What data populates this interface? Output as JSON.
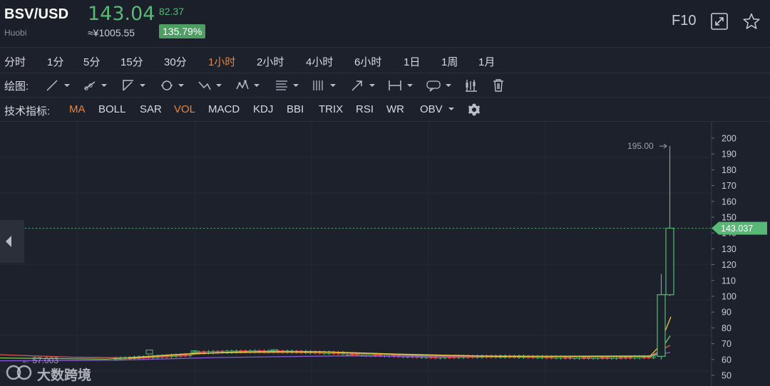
{
  "header": {
    "symbol": "BSV/USD",
    "exchange": "Huobi",
    "last_price": "143.04",
    "cny_price": "≈¥1005.55",
    "change": "82.37",
    "change_pct": "135.79%",
    "f10_label": "F10",
    "up_color": "#58b977"
  },
  "periods": {
    "items": [
      "分时",
      "1分",
      "5分",
      "15分",
      "30分",
      "1小时",
      "2小时",
      "4小时",
      "6小时",
      "1日",
      "1周",
      "1月"
    ],
    "active": "1小时",
    "active_color": "#e8843f"
  },
  "drawing_toolbar": {
    "label": "绘图:",
    "tools": [
      "line-tool-icon",
      "ray-tool-icon",
      "channel-tool-icon",
      "circle-tool-icon",
      "wave-tool-icon",
      "pattern-tool-icon",
      "fibonacci-tool-icon",
      "gann-tool-icon",
      "arrow-tool-icon",
      "measure-tool-icon",
      "note-tool-icon",
      "candle-settings-icon",
      "trash-icon"
    ]
  },
  "indicator_toolbar": {
    "label": "技术指标:",
    "items": [
      "MA",
      "BOLL",
      "SAR",
      "VOL",
      "MACD",
      "KDJ",
      "BBI",
      "TRIX",
      "RSI",
      "WR",
      "OBV"
    ],
    "active": [
      "MA",
      "VOL"
    ]
  },
  "chart_data": {
    "type": "candlestick",
    "y_axis_ticks": [
      200,
      190,
      180,
      170,
      160,
      150,
      140,
      130,
      120,
      110,
      100,
      90,
      80,
      70,
      60,
      50
    ],
    "ylim": [
      45,
      203
    ],
    "grid": true,
    "high_label": "195.00",
    "current_price_label": "143.037",
    "low_label": "57.003",
    "candles": [
      {
        "o": 62.0,
        "h": 114.0,
        "l": 60.0,
        "c": 101.0
      },
      {
        "o": 101.0,
        "h": 195.0,
        "l": 100.0,
        "c": 143.04
      }
    ],
    "colors": {
      "up": "#58b977",
      "down": "#e0504f",
      "ma_yellow": "#e8c840",
      "ma_green": "#7ccf5a",
      "ma_red": "#e05a4f",
      "ma_purple": "#8a5ad6"
    }
  },
  "watermark": {
    "text": "大数跨境"
  }
}
